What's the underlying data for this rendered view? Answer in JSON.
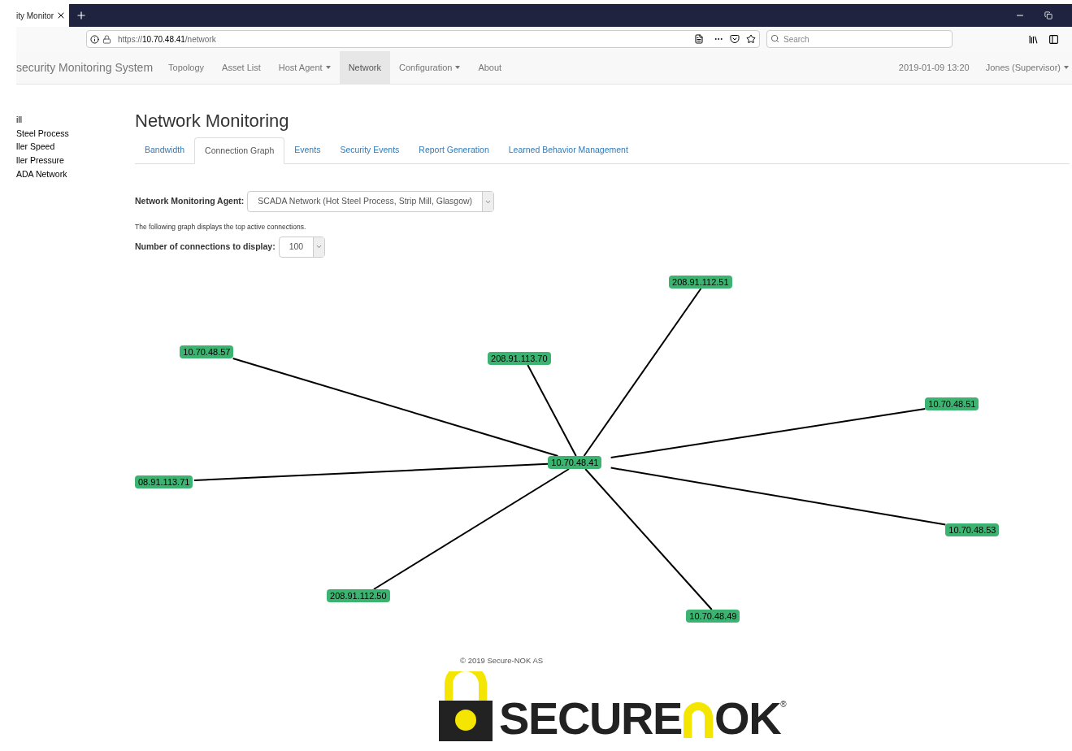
{
  "browser": {
    "tab_title": "ity Monitor",
    "url_prefix": "https://",
    "url_host": "10.70.48.41",
    "url_path": "/network",
    "search": {
      "placeholder": "Search"
    }
  },
  "navbar": {
    "brand": "security Monitoring System",
    "items": [
      {
        "label": "Topology",
        "dropdown": false,
        "selected": false
      },
      {
        "label": "Asset List",
        "dropdown": false,
        "selected": false
      },
      {
        "label": "Host Agent",
        "dropdown": true,
        "selected": false
      },
      {
        "label": "Network",
        "dropdown": false,
        "selected": true
      },
      {
        "label": "Configuration",
        "dropdown": true,
        "selected": false
      },
      {
        "label": "About",
        "dropdown": false,
        "selected": false
      }
    ],
    "datetime": "2019-01-09 13:20",
    "user": "Jones (Supervisor)"
  },
  "sidebar": {
    "items": [
      "ill",
      "Steel Process",
      "ller Speed",
      "ller Pressure",
      "ADA Network"
    ]
  },
  "page": {
    "title": "Network Monitoring",
    "tabs": [
      {
        "label": "Bandwidth",
        "selected": false
      },
      {
        "label": "Connection Graph",
        "selected": true
      },
      {
        "label": "Events",
        "selected": false
      },
      {
        "label": "Security Events",
        "selected": false
      },
      {
        "label": "Report Generation",
        "selected": false
      },
      {
        "label": "Learned Behavior Management",
        "selected": false
      }
    ],
    "agent_label": "Network Monitoring Agent:",
    "agent_value": "SCADA Network (Hot Steel Process, Strip Mill, Glasgow)",
    "description": "The following graph displays the top active connections.",
    "count_label": "Number of connections to display:",
    "count_value": "100"
  },
  "graph": {
    "center": "10.70.48.41",
    "nodes": [
      {
        "label": "208.91.112.51"
      },
      {
        "label": "10.70.48.57"
      },
      {
        "label": "208.91.113.70"
      },
      {
        "label": "10.70.48.51"
      },
      {
        "label": "08.91.113.71"
      },
      {
        "label": "10.70.48.53"
      },
      {
        "label": "208.91.112.50"
      },
      {
        "label": "10.70.48.49"
      }
    ]
  },
  "footer": {
    "copyright": "© 2019 Secure-NOK AS",
    "logo_left": "SECURE",
    "logo_right": "OK",
    "logo_mark": "®"
  }
}
